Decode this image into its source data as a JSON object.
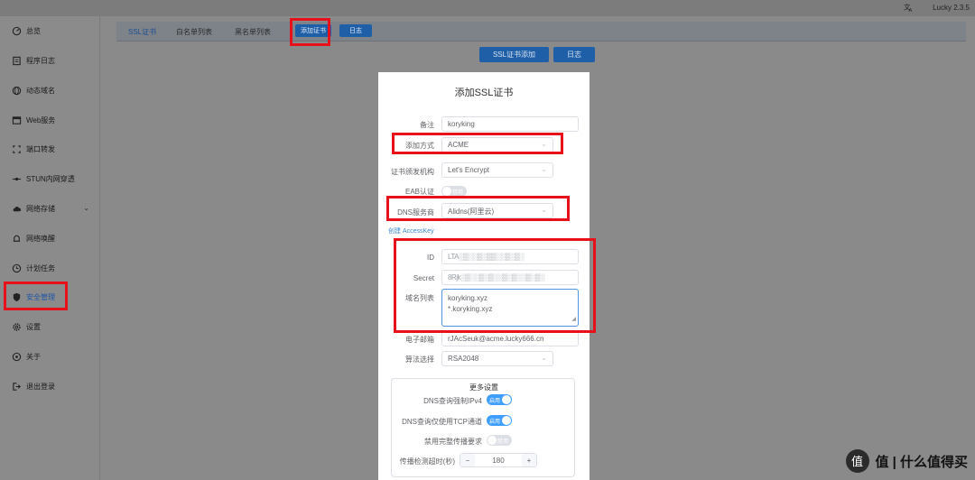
{
  "topbar": {
    "lang_icon": "translate-icon",
    "brand": "Lucky 2.3.5"
  },
  "sidebar": {
    "items": [
      {
        "label": "总览",
        "icon": "dashboard-icon"
      },
      {
        "label": "程序日志",
        "icon": "log-icon"
      },
      {
        "label": "动态域名",
        "icon": "globe-icon"
      },
      {
        "label": "Web服务",
        "icon": "window-icon"
      },
      {
        "label": "端口转发",
        "icon": "port-icon"
      },
      {
        "label": "STUN内网穿透",
        "icon": "stun-icon"
      },
      {
        "label": "网络存储",
        "icon": "cloud-icon"
      },
      {
        "label": "网络唤醒",
        "icon": "bell-icon"
      },
      {
        "label": "计划任务",
        "icon": "clock-icon"
      },
      {
        "label": "安全管理",
        "icon": "shield-icon"
      },
      {
        "label": "设置",
        "icon": "gear-icon"
      },
      {
        "label": "关于",
        "icon": "info-icon"
      },
      {
        "label": "退出登录",
        "icon": "logout-icon"
      }
    ]
  },
  "tabs": {
    "ssl": "SSL证书",
    "whitelist": "白名单列表",
    "blacklist": "黑名单列表",
    "add_cert": "添加证书",
    "log": "日志"
  },
  "toolbar": {
    "add_ssl": "SSL证书添加",
    "log": "日志"
  },
  "dialog": {
    "title": "添加SSL证书",
    "remark_label": "备注",
    "remark_value": "koryking",
    "method_label": "添加方式",
    "method_value": "ACME",
    "ca_label": "证书颁发机构",
    "ca_value": "Let's Encrypt",
    "eab_label": "EAB认证",
    "eab_state": "禁用",
    "dns_label": "DNS服务商",
    "dns_value": "Alidns(阿里云)",
    "create_key_link": "创建 AccessKey",
    "id_label": "ID",
    "id_value": "LTA░▒░░▒░▒▒░░▒░▒░",
    "secret_label": "Secret",
    "secret_value": "8Rjk░▒░░▒░▒░░▒░▒░░▒░▒░",
    "domains_label": "域名列表",
    "domains": [
      "koryking.xyz",
      "*.koryking.xyz"
    ],
    "email_label": "电子邮箱",
    "email_value": "rJAcSeuk@acme.lucky666.cn",
    "algo_label": "算法选择",
    "algo_value": "RSA2048",
    "more_settings": "更多设置",
    "dns_ipv4_label": "DNS查询强制IPv4",
    "dns_ipv4_state": "启用",
    "dns_tcp_label": "DNS查询仅使用TCP通道",
    "dns_tcp_state": "启用",
    "disable_propagation_label": "禁用完整传播要求",
    "disable_propagation_state": "禁用",
    "timeout_label": "传播检测超时(秒)",
    "timeout_value": "180",
    "minus": "−",
    "plus": "+"
  },
  "watermark": {
    "text": "值 | 什么值得买",
    "logo": "值"
  },
  "colors": {
    "primary": "#409eff",
    "highlight": "#e8101a",
    "active_nav": "#1e56a8"
  }
}
